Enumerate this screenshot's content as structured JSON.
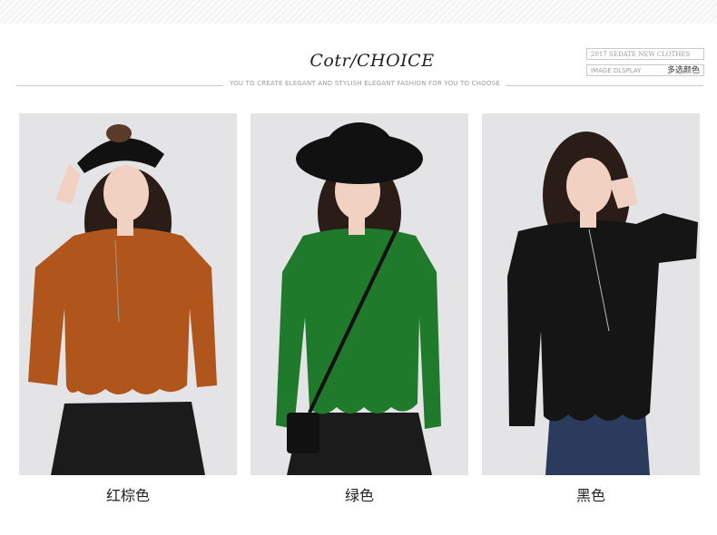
{
  "header": {
    "title": "Cotr/CHOICE",
    "subtitle": "YOU TO CREATE ELEGANT AND STYLISH ELEGANT FASHION FOR YOU TO CHOOSE",
    "tag_new": "2017 SEDATE NEW CLOTHES",
    "tag_display": "IMAGE DLSPLAY",
    "tag_display_cn": "多选颜色"
  },
  "products": [
    {
      "caption": "红棕色",
      "color": "#b0561c",
      "skirt": "#1b1b1b"
    },
    {
      "caption": "绿色",
      "color": "#1f7a2c",
      "skirt": "#1b1b1b"
    },
    {
      "caption": "黑色",
      "color": "#151515",
      "skirt": "#2b3b5e"
    }
  ]
}
